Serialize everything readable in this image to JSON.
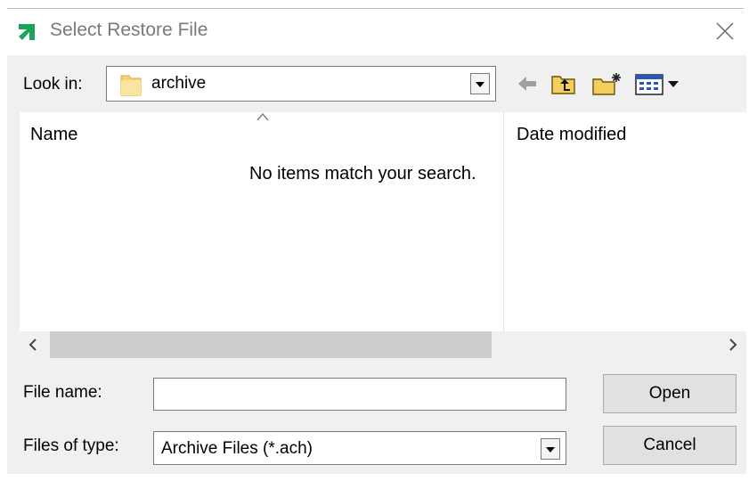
{
  "window": {
    "title": "Select Restore File",
    "accent_color": "#1aa35a",
    "close_icon": "close-icon"
  },
  "look_in": {
    "label": "Look in:",
    "value": "archive",
    "icon": "folder-icon"
  },
  "toolbar": {
    "back_icon": "back-arrow-icon",
    "up_icon": "up-one-level-icon",
    "new_folder_icon": "new-folder-icon",
    "view_icon": "view-menu-icon"
  },
  "file_list": {
    "columns": [
      "Name",
      "Date modified"
    ],
    "empty_message": "No items match your search."
  },
  "file_name": {
    "label": "File name:",
    "value": "",
    "placeholder": ""
  },
  "file_type": {
    "label": "Files of type:",
    "value": "Archive Files (*.ach)"
  },
  "buttons": {
    "open": "Open",
    "cancel": "Cancel"
  }
}
